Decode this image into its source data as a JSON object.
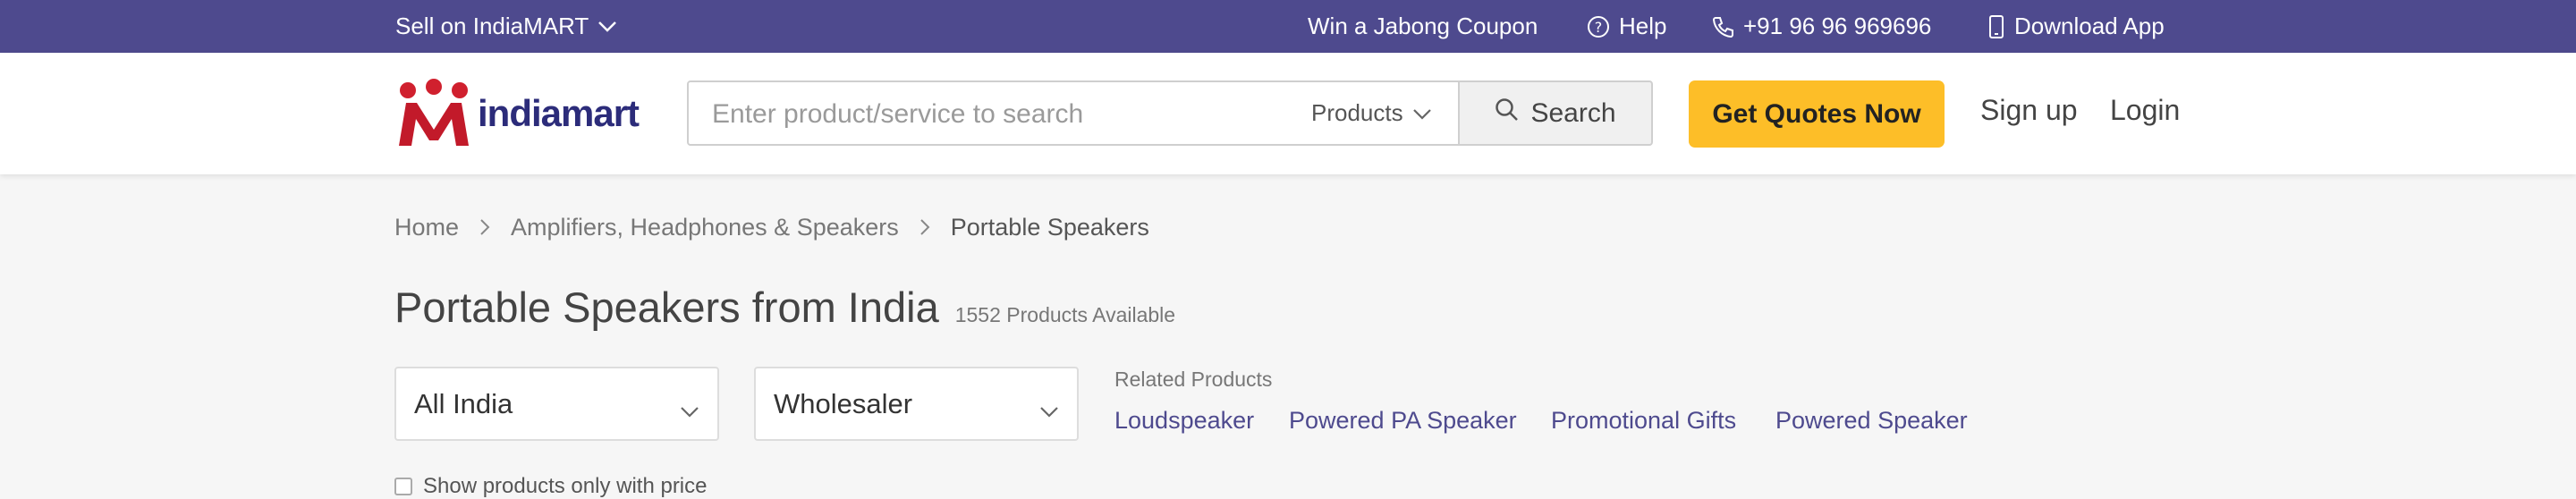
{
  "topbar": {
    "sell_label": "Sell on IndiaMART",
    "coupon_label": "Win a Jabong Coupon",
    "help_label": "Help",
    "phone_label": "+91 96 96 969696",
    "download_label": "Download App"
  },
  "header": {
    "logo_text": "indiamart",
    "search_placeholder": "Enter product/service to search",
    "category_label": "Products",
    "search_button_label": "Search",
    "quotes_button_label": "Get Quotes Now",
    "signup_label": "Sign up",
    "login_label": "Login"
  },
  "breadcrumb": {
    "home": "Home",
    "category": "Amplifiers, Headphones & Speakers",
    "current": "Portable Speakers"
  },
  "page": {
    "title": "Portable Speakers from India",
    "count": "1552 Products Available"
  },
  "filters": {
    "location": "All India",
    "business_type": "Wholesaler",
    "price_only_label": "Show products only with price"
  },
  "related": {
    "label": "Related Products",
    "items": [
      "Loudspeaker",
      "Powered PA Speaker",
      "Promotional Gifts",
      "Powered Speaker"
    ]
  },
  "colors": {
    "brand_purple": "#4e4a8e",
    "accent_yellow": "#fdbe28",
    "logo_red": "#d0202e"
  }
}
